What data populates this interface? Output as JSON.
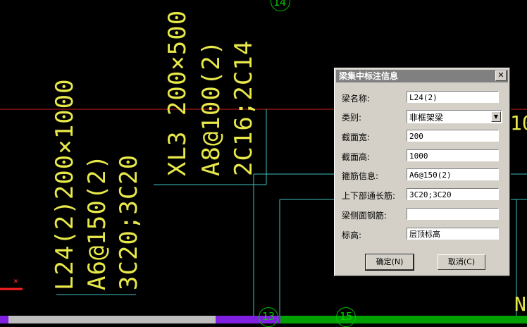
{
  "cad": {
    "left_beam": {
      "line1": "L24(2)200×1000",
      "line2": "A6@150(2)",
      "line3": "3C20;3C20"
    },
    "center_beam": {
      "line1": "XL3 200×500",
      "line2": "A8@100(2)",
      "line3": "2C16;2C14"
    },
    "axis_labels": {
      "top": "14",
      "bottom_13": "13",
      "bottom_15": "15"
    },
    "right_fragments": {
      "r1": "10",
      "r2": "N"
    }
  },
  "dialog": {
    "title": "梁集中标注信息",
    "close_label": "✕",
    "fields": {
      "name_label": "梁名称:",
      "name_value": "L24(2)",
      "type_label": "类别:",
      "type_value": "非框架梁",
      "width_label": "截面宽:",
      "width_value": "200",
      "height_label": "截面高:",
      "height_value": "1000",
      "stirrup_label": "箍筋信息:",
      "stirrup_value": "A6@150(2)",
      "long_bar_label": "上下部通长筋:",
      "long_bar_value": "3C20;3C20",
      "side_bar_label": "梁侧面钢筋:",
      "side_bar_value": "",
      "elevation_label": "标高:",
      "elevation_value": "层顶标高"
    },
    "ok_label": "确定(N)",
    "cancel_label": "取消(C)"
  }
}
